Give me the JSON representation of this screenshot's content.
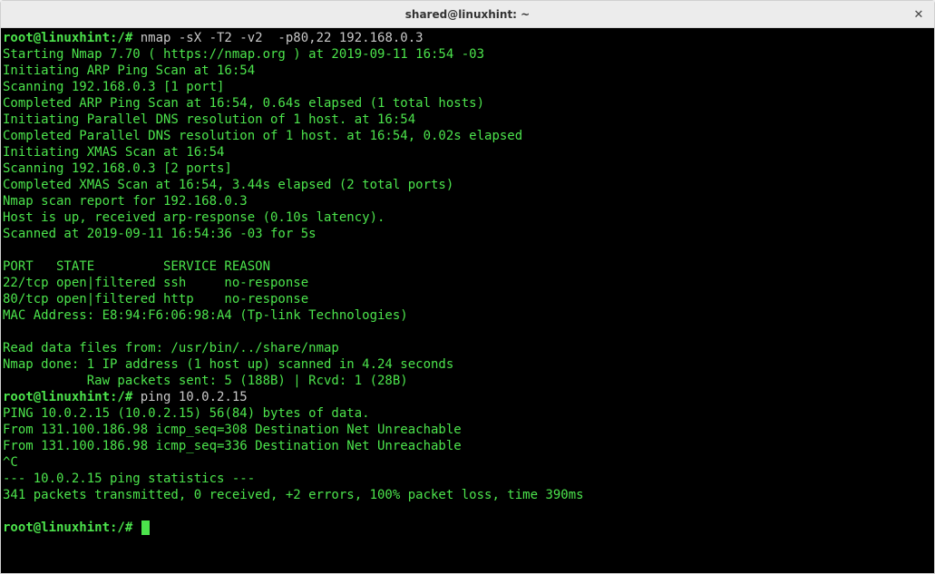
{
  "window": {
    "title": "shared@linuxhint: ~"
  },
  "icons": {
    "close": "✕"
  },
  "prompt": "root@linuxhint:/# ",
  "cmd1": "nmap -sX -T2 -v2  -p80,22 192.168.0.3",
  "out1_l01": "Starting Nmap 7.70 ( https://nmap.org ) at 2019-09-11 16:54 -03",
  "out1_l02": "Initiating ARP Ping Scan at 16:54",
  "out1_l03": "Scanning 192.168.0.3 [1 port]",
  "out1_l04": "Completed ARP Ping Scan at 16:54, 0.64s elapsed (1 total hosts)",
  "out1_l05": "Initiating Parallel DNS resolution of 1 host. at 16:54",
  "out1_l06": "Completed Parallel DNS resolution of 1 host. at 16:54, 0.02s elapsed",
  "out1_l07": "Initiating XMAS Scan at 16:54",
  "out1_l08": "Scanning 192.168.0.3 [2 ports]",
  "out1_l09": "Completed XMAS Scan at 16:54, 3.44s elapsed (2 total ports)",
  "out1_l10": "Nmap scan report for 192.168.0.3",
  "out1_l11": "Host is up, received arp-response (0.10s latency).",
  "out1_l12": "Scanned at 2019-09-11 16:54:36 -03 for 5s",
  "out1_l13": "",
  "out1_l14": "PORT   STATE         SERVICE REASON",
  "out1_l15": "22/tcp open|filtered ssh     no-response",
  "out1_l16": "80/tcp open|filtered http    no-response",
  "out1_l17": "MAC Address: E8:94:F6:06:98:A4 (Tp-link Technologies)",
  "out1_l18": "",
  "out1_l19": "Read data files from: /usr/bin/../share/nmap",
  "out1_l20": "Nmap done: 1 IP address (1 host up) scanned in 4.24 seconds",
  "out1_l21": "           Raw packets sent: 5 (188B) | Rcvd: 1 (28B)",
  "cmd2": "ping 10.0.2.15",
  "out2_l01": "PING 10.0.2.15 (10.0.2.15) 56(84) bytes of data.",
  "out2_l02": "From 131.100.186.98 icmp_seq=308 Destination Net Unreachable",
  "out2_l03": "From 131.100.186.98 icmp_seq=336 Destination Net Unreachable",
  "out2_l04": "^C",
  "out2_l05": "--- 10.0.2.15 ping statistics ---",
  "out2_l06": "341 packets transmitted, 0 received, +2 errors, 100% packet loss, time 390ms",
  "out2_l07": ""
}
